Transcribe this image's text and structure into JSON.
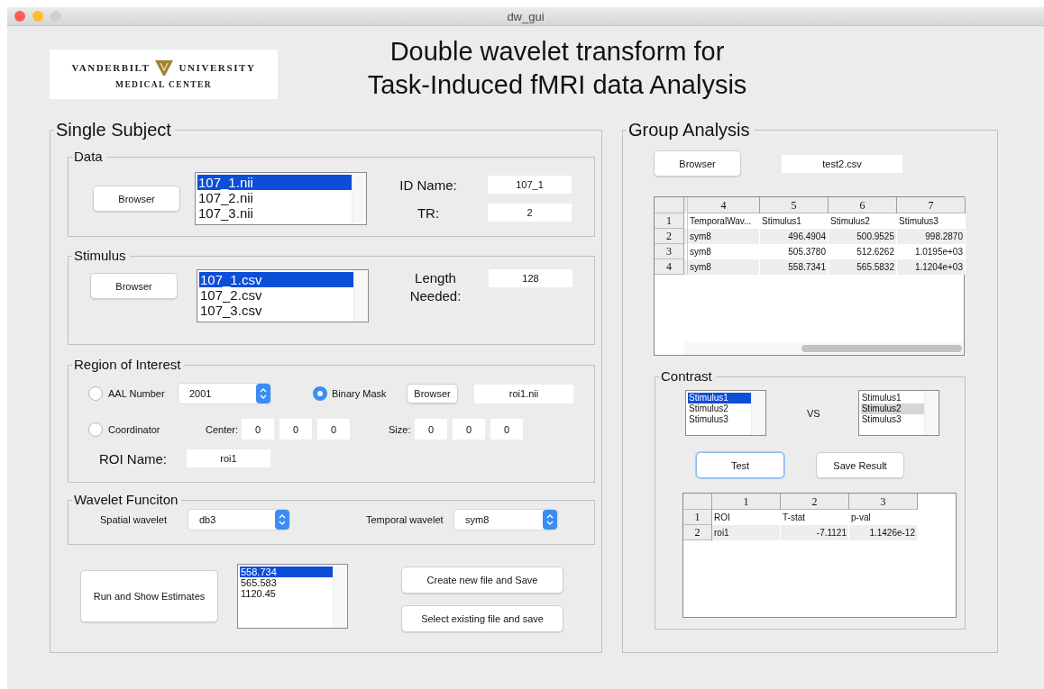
{
  "window": {
    "title": "dw_gui"
  },
  "logo": {
    "name_left": "VANDERBILT",
    "name_right": "UNIVERSITY",
    "subtitle": "MEDICAL CENTER"
  },
  "title_lines": [
    "Double wavelet transform for",
    "Task-Induced fMRI data Analysis"
  ],
  "single_subject": {
    "title": "Single Subject",
    "data": {
      "title": "Data",
      "button": "Browser",
      "focused": true,
      "files": [
        {
          "label": "107_1.nii",
          "selected": true
        },
        {
          "label": "107_2.nii",
          "selected": false
        },
        {
          "label": "107_3.nii",
          "selected": false
        }
      ],
      "id_label": "ID Name:",
      "id_value": "107_1",
      "tr_label": "TR:",
      "tr_value": "2"
    },
    "stimulus": {
      "title": "Stimulus",
      "button": "Browser",
      "focused": true,
      "files": [
        {
          "label": "107_1.csv",
          "selected": true
        },
        {
          "label": "107_2.csv",
          "selected": false
        },
        {
          "label": "107_3.csv",
          "selected": false
        }
      ],
      "length_label": "Length Needed:",
      "length_value": "128"
    },
    "roi": {
      "title": "Region of Interest",
      "options": [
        {
          "label": "AAL Number",
          "selected": false
        },
        {
          "label": "Binary Mask",
          "selected": true
        },
        {
          "label": "Coordinator",
          "selected": false
        }
      ],
      "aal_value": "2001",
      "mask_button": "Browser",
      "mask_file": "roi1.nii",
      "center_label": "Center:",
      "center": [
        "0",
        "0",
        "0"
      ],
      "size_label": "Size:",
      "size": [
        "0",
        "0",
        "0"
      ],
      "name_label": "ROI Name:",
      "name_value": "roi1"
    },
    "wavelet": {
      "title": "Wavelet Funciton",
      "spatial_label": "Spatial wavelet",
      "spatial_value": "db3",
      "temporal_label": "Temporal wavelet",
      "temporal_value": "sym8"
    },
    "run_button": "Run and Show Estimates",
    "estimates": {
      "focused": true,
      "items": [
        {
          "label": "558.734",
          "selected": true
        },
        {
          "label": "565.583",
          "selected": false
        },
        {
          "label": "1120.45",
          "selected": false
        }
      ]
    },
    "save_buttons": [
      "Create new file and Save",
      "Select existing file and save"
    ]
  },
  "group": {
    "title": "Group Analysis",
    "button": "Browser",
    "file": "test2.csv",
    "table": {
      "columns": [
        "4",
        "5",
        "6",
        "7"
      ],
      "rows": [
        {
          "header": "1",
          "kind": "labels",
          "cells": [
            "TemporalWav...",
            "Stimulus1",
            "Stimulus2",
            "Stimulus3"
          ]
        },
        {
          "header": "2",
          "kind": "values",
          "cells": [
            "sym8",
            "496.4904",
            "500.9525",
            "998.2870"
          ]
        },
        {
          "header": "3",
          "kind": "values",
          "cells": [
            "sym8",
            "505.3780",
            "512.6262",
            "1.0195e+03"
          ]
        },
        {
          "header": "4",
          "kind": "values",
          "cells": [
            "sym8",
            "558.7341",
            "565.5832",
            "1.1204e+03"
          ]
        }
      ]
    },
    "contrast": {
      "title": "Contrast",
      "left": {
        "focused": true,
        "items": [
          {
            "label": "Stimulus1",
            "selected": true
          },
          {
            "label": "Stimulus2",
            "selected": false
          },
          {
            "label": "Stimulus3",
            "selected": false
          }
        ]
      },
      "vs": "VS",
      "right": {
        "focused": false,
        "items": [
          {
            "label": "Stimulus1",
            "selected": false
          },
          {
            "label": "Stimulus2",
            "selected": true
          },
          {
            "label": "Stimulus3",
            "selected": false
          }
        ]
      },
      "test_button": {
        "label": "Test",
        "focused": true
      },
      "save_button": {
        "label": "Save Result",
        "focused": false
      },
      "table": {
        "columns": [
          "1",
          "2",
          "3"
        ],
        "rows": [
          {
            "header": "1",
            "kind": "labels",
            "cells": [
              "ROI",
              "T-stat",
              "p-val"
            ]
          },
          {
            "header": "2",
            "kind": "values",
            "cells": [
              "roi1",
              "-7.1121",
              "1.1426e-12"
            ]
          }
        ]
      }
    }
  }
}
